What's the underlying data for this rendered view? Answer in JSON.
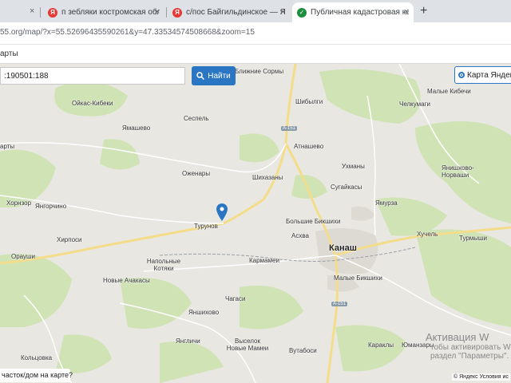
{
  "browser": {
    "tabs": [
      {
        "title": "п зебляки костромская облас"
      },
      {
        "title": "с/пос Байгильдинское — Янде"
      },
      {
        "title": "Публичная кадастровая карт"
      }
    ],
    "close_glyph": "×",
    "new_tab_glyph": "+",
    "url": "55.org/map/?x=55.52696435590261&y=47.33534574508668&zoom=15"
  },
  "page": {
    "toolbar_label": "арты",
    "search": {
      "value": ":190501:188",
      "button_label": "Найти"
    },
    "layer_switch": {
      "label": "Карта Яндекс"
    },
    "bottom_link": "часток/дом на карте?",
    "attribution": "© Яндекс  Условия ис"
  },
  "map": {
    "towns": [
      {
        "name": "Ближние Сормы"
      },
      {
        "name": "Ойкас-Кибеки"
      },
      {
        "name": "Шибылги"
      },
      {
        "name": "Челкумаги"
      },
      {
        "name": "Малые Кибечи"
      },
      {
        "name": "Ямашево"
      },
      {
        "name": "Сеспель"
      },
      {
        "name": "Атнашево"
      },
      {
        "name": "арты"
      },
      {
        "name": "Ухманы"
      },
      {
        "name": "Янишхово-Норваши"
      },
      {
        "name": "Оженары"
      },
      {
        "name": "Шихазаны"
      },
      {
        "name": "Сугайкасы"
      },
      {
        "name": "Хорнзор"
      },
      {
        "name": "Янгорчино"
      },
      {
        "name": "Ямурза"
      },
      {
        "name": "Турунов"
      },
      {
        "name": "Большие Бикшихи"
      },
      {
        "name": "Хучель"
      },
      {
        "name": "Турмыши"
      },
      {
        "name": "Хирпоси"
      },
      {
        "name": "Асхва"
      },
      {
        "name": "Орауши"
      },
      {
        "name": "Напольные Котяки"
      },
      {
        "name": "Кармамеи"
      },
      {
        "name": "Малые Бикшихи"
      },
      {
        "name": "Новые Ачакасы"
      },
      {
        "name": "Чагаси"
      },
      {
        "name": "Яншихово"
      },
      {
        "name": "Янгличи"
      },
      {
        "name": "Выселок Новые Мамеи"
      },
      {
        "name": "Вутабоси"
      },
      {
        "name": "Караклы"
      },
      {
        "name": "Юманзары"
      },
      {
        "name": "Кольцовка"
      }
    ],
    "city": "Канаш",
    "roads": [
      {
        "label": "А-151"
      },
      {
        "label": "А-151"
      }
    ],
    "colors": {
      "land": "#e9e7e1",
      "forest": "#cfe3b5",
      "urban": "#ddd9d3",
      "road": "#f4dd8a",
      "accent": "#2b76c3"
    }
  },
  "watermark": {
    "title": "Активация W",
    "line1": "тобы активировать W",
    "line2": "раздел \"Параметры\"."
  },
  "icons": [
    "yandex-favicon",
    "check-favicon",
    "search-icon",
    "map-pin-icon"
  ]
}
